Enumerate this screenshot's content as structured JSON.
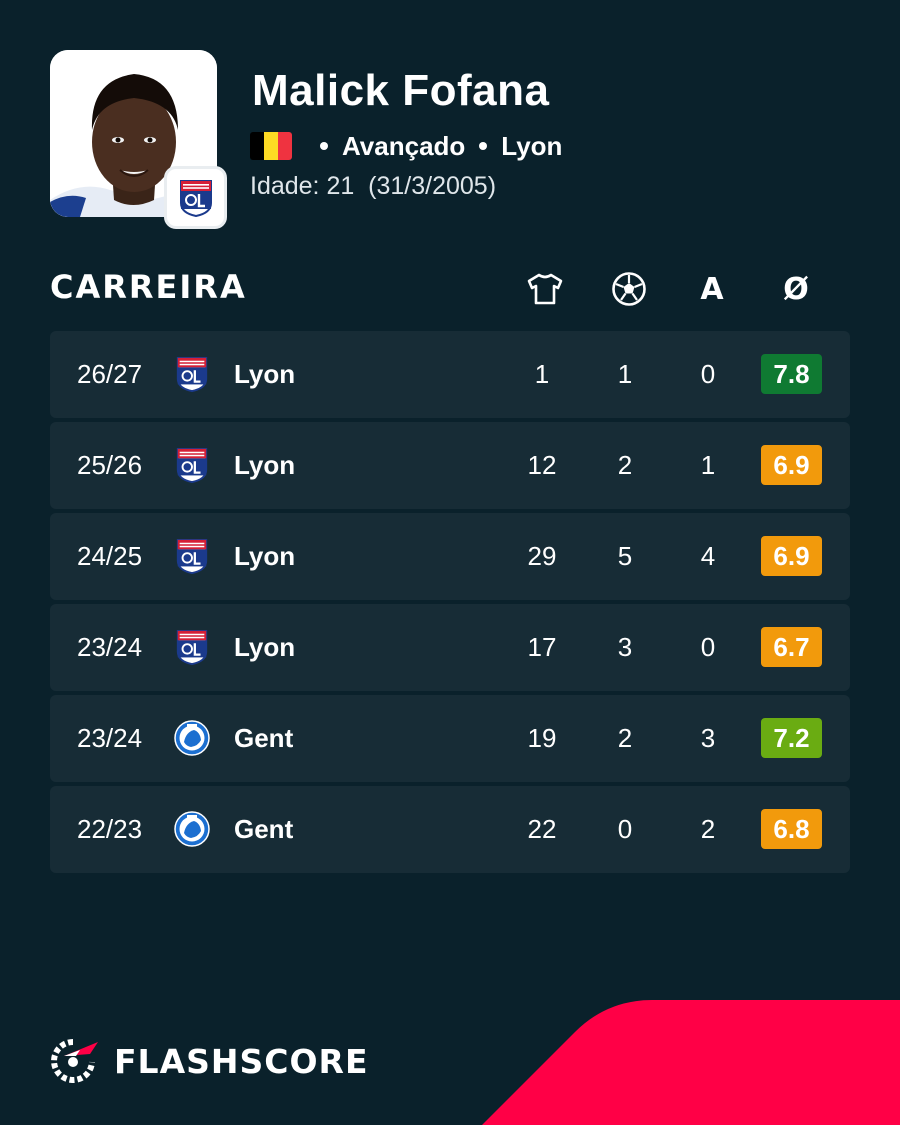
{
  "player": {
    "name": "Malick Fofana",
    "flag_colors": [
      "#000000",
      "#FDDA24",
      "#EF3340"
    ],
    "position": "Avançado",
    "club": "Lyon",
    "age_label": "Idade: 21  (31/3/2005)"
  },
  "career": {
    "title": "CARREIRA",
    "columns": [
      {
        "icon": "shirt-icon"
      },
      {
        "icon": "ball-icon"
      },
      {
        "label": "A"
      },
      {
        "label": "Ø"
      }
    ],
    "rows": [
      {
        "season": "26/27",
        "team": "Lyon",
        "logo": "lyon-logo",
        "apps": "1",
        "goals": "1",
        "assists": "0",
        "rating": "7.8",
        "rating_color": "#0f7a32"
      },
      {
        "season": "25/26",
        "team": "Lyon",
        "logo": "lyon-logo",
        "apps": "12",
        "goals": "2",
        "assists": "1",
        "rating": "6.9",
        "rating_color": "#f29a0c"
      },
      {
        "season": "24/25",
        "team": "Lyon",
        "logo": "lyon-logo",
        "apps": "29",
        "goals": "5",
        "assists": "4",
        "rating": "6.9",
        "rating_color": "#f29a0c"
      },
      {
        "season": "23/24",
        "team": "Lyon",
        "logo": "lyon-logo",
        "apps": "17",
        "goals": "3",
        "assists": "0",
        "rating": "6.7",
        "rating_color": "#f29a0c"
      },
      {
        "season": "23/24",
        "team": "Gent",
        "logo": "gent-logo",
        "apps": "19",
        "goals": "2",
        "assists": "3",
        "rating": "7.2",
        "rating_color": "#6aac12"
      },
      {
        "season": "22/23",
        "team": "Gent",
        "logo": "gent-logo",
        "apps": "22",
        "goals": "0",
        "assists": "2",
        "rating": "6.8",
        "rating_color": "#f29a0c"
      }
    ]
  },
  "brand": {
    "name": "FLASHSCORE",
    "accent": "#ff0046"
  }
}
